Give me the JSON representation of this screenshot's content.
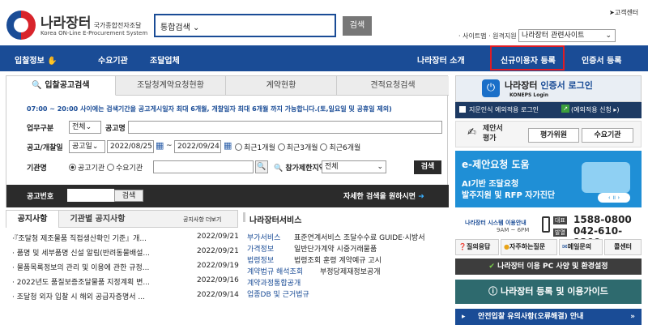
{
  "header": {
    "logo_title": "나라장터",
    "logo_sub": "국가종합전자조달",
    "logo_en": "Korea ON-Line E-Procurement System",
    "search_scope": "통합검색",
    "search_button": "검색",
    "customer_center": "고객센터",
    "sitemap_text": "· 사이트맵 · 원격지원",
    "related_sites": "나라장터 관련사이트"
  },
  "nav": {
    "items": [
      "입찰정보",
      "수요기관",
      "조달업체",
      "나라장터 소개",
      "신규이용자 등록",
      "인증서 등록"
    ]
  },
  "search": {
    "tabs": [
      "입찰공고검색",
      "조달청계약요청현황",
      "계약현황",
      "견적요청검색"
    ],
    "notice": "07:00 ~ 20:00 사이에는 검색기간을 공고게시일자 최대 6개월, 개찰일자 최대 6개월 까지 가능합니다.(토,일요일 및 공휴일 제외)",
    "task_label": "업무구분",
    "task_value": "전체",
    "name_label": "공고명",
    "date_label": "공고/개찰일",
    "date_type": "공고일",
    "date_from": "2022/08/25",
    "date_sep": "~",
    "date_to": "2022/09/24",
    "period_options": [
      "최근1개월",
      "최근3개월",
      "최근6개월"
    ],
    "agency_label": "기관명",
    "agency_options": [
      "공고기관",
      "수요기관"
    ],
    "region_label": "참가제한지역",
    "region_value": "전체",
    "search_btn": "검색",
    "bid_no_label": "공고번호",
    "bid_search_btn": "검색",
    "detail_link": "자세한 검색을 원하시면"
  },
  "notices": {
    "tabs": [
      "공지사항",
      "기관별 공지사항"
    ],
    "more": "공지사항 더보기",
    "items": [
      {
        "title": "·『조달청 제조물품 직접생산확인 기준』개...",
        "date": "2022/09/21"
      },
      {
        "title": "· 품명 및 세부품명 신설 알림(반려동물배설...",
        "date": "2022/09/21"
      },
      {
        "title": "· 물품목록정보의 관리 및 이용에 관한 규정...",
        "date": "2022/09/19"
      },
      {
        "title": "· 2022년도 품질보증조달물품 지정계획 변...",
        "date": "2022/09/16"
      },
      {
        "title": "· 조달청 외자 입찰 시 해외 공급자증명서 ...",
        "date": "2022/09/14"
      }
    ]
  },
  "services": {
    "title": "나라장터서비스",
    "rows": [
      {
        "label": "부가서비스",
        "text": "표준연계서비스  조달수수료 GUIDE·시방서"
      },
      {
        "label": "가격정보",
        "text": "일반단가계약  시중거래물품"
      },
      {
        "label": "법령정보",
        "text": "법령조회  훈령  계약예규  고시"
      },
      {
        "label": "계약법규 해석조회",
        "text": "부정당제재정보공개"
      },
      {
        "label": "계약과정통합공개",
        "text": ""
      },
      {
        "label": "업종DB 및 근거법규",
        "text": ""
      }
    ]
  },
  "right": {
    "login_title": "나라장터",
    "login_title2": "인증서 로그인",
    "login_sub": "KONEPS Login",
    "bio_login": "지문인식 예외적용 로그인",
    "bio_apply": "(예외적용 신청",
    "proposal": "제안서\n평가",
    "eval_btn": "평가위원",
    "agency_btn": "수요기관",
    "banner_title": "e-제안요청 도움",
    "banner_sub1": "AI기반 조달요청",
    "banner_sub2": "발주지원 및 RFP 자가진단",
    "hours_label": "나라장터 시스템 이용안내",
    "hours": "9AM ~ 6PM",
    "phone_tag1": "대표",
    "phone1": "1588-0800",
    "phone_tag2": "발열",
    "phone2": "042-610-1200",
    "quick": [
      "질의응답",
      "자주하는질문",
      "메일문의",
      "콜센터"
    ],
    "pc_env": "나라장터 이용 PC 사양 및 환경설정",
    "guide": "나라장터 등록 및 이용가이드",
    "safety": "안전입찰 유의사항(오류해결) 안내"
  },
  "colors": {
    "primary": "#1a4c96",
    "highlight": "#e01c24",
    "dark": "#2b2b2b"
  }
}
